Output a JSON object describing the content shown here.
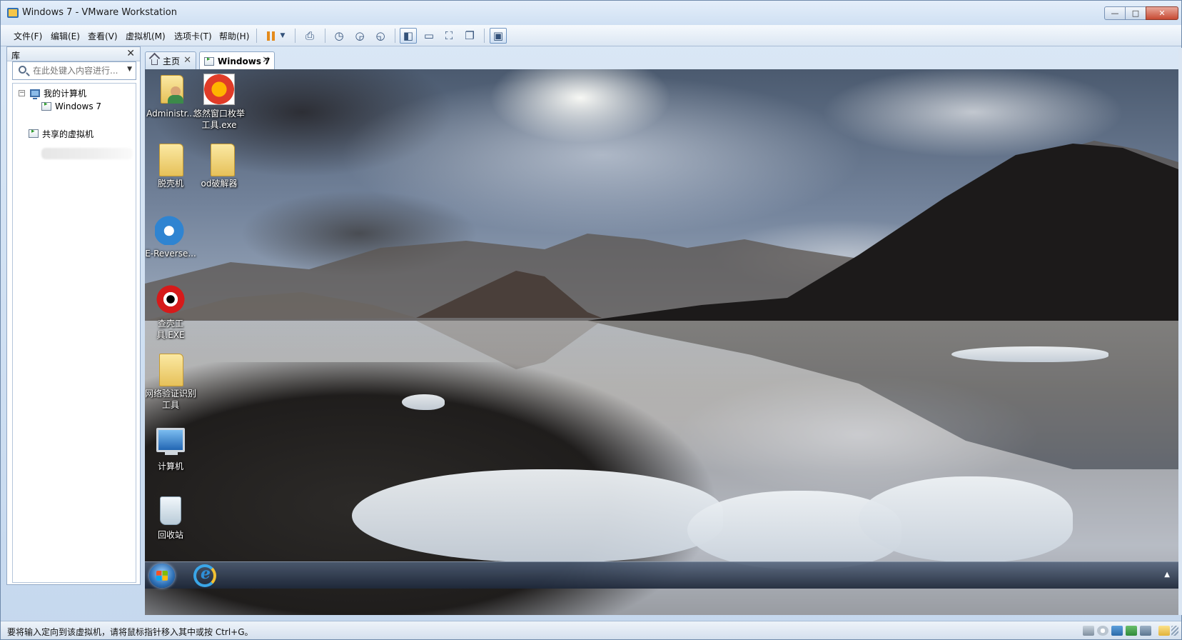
{
  "window": {
    "title": "Windows 7 - VMware Workstation",
    "minimize": "—",
    "maximize": "□",
    "close": "✕"
  },
  "menu": {
    "items": [
      "文件(F)",
      "编辑(E)",
      "查看(V)",
      "虚拟机(M)",
      "选项卡(T)",
      "帮助(H)"
    ]
  },
  "library": {
    "title": "库",
    "close": "✕",
    "search_placeholder": "在此处键入内容进行...",
    "tree": {
      "my_computer": "我的计算机",
      "vm": "Windows 7",
      "shared": "共享的虚拟机"
    }
  },
  "tabs": [
    {
      "label": "主页",
      "active": false
    },
    {
      "label": "Windows 7",
      "active": true
    }
  ],
  "desktop": {
    "icons": [
      {
        "label": "Administr...",
        "kind": "user-folder-icon"
      },
      {
        "label": "悠然窗口枚举工具.exe",
        "kind": "app-exe-icon"
      },
      {
        "label": "脱壳机",
        "kind": "folder-icon"
      },
      {
        "label": "od破解器",
        "kind": "folder-icon"
      },
      {
        "label": "E-Reverse...",
        "kind": "app-icon"
      },
      {
        "label": "查壳工具.EXE",
        "kind": "app-icon"
      },
      {
        "label": "网络验证识别工具",
        "kind": "folder-icon"
      },
      {
        "label": "计算机",
        "kind": "computer-icon"
      },
      {
        "label": "回收站",
        "kind": "recycle-bin-icon"
      }
    ]
  },
  "taskbar": {
    "tray_arrow": "▲"
  },
  "status": {
    "message": "要将输入定向到该虚拟机，请将鼠标指针移入其中或按 Ctrl+G。"
  },
  "colors": {
    "titlebar": "#cfe0f3",
    "accent": "#2f6fb5",
    "taskbar": "#1e283a"
  }
}
